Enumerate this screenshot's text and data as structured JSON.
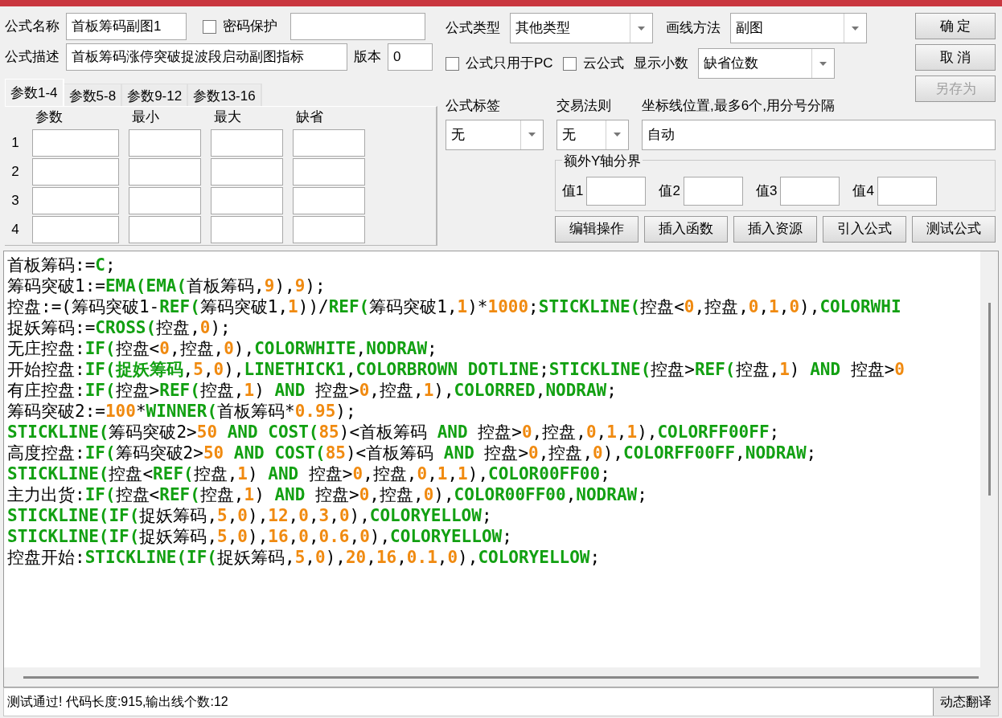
{
  "form": {
    "name_label": "公式名称",
    "name_value": "首板筹码副图1",
    "password": {
      "label": "密码保护",
      "checked": false
    },
    "desc_label": "公式描述",
    "desc_value": "首板筹码涨停突破捉波段启动副图指标",
    "version_label": "版本",
    "version_value": "0"
  },
  "param_tabs": [
    {
      "label": "参数1-4",
      "selected": true
    },
    {
      "label": "参数5-8",
      "selected": false
    },
    {
      "label": "参数9-12",
      "selected": false
    },
    {
      "label": "参数13-16",
      "selected": false
    }
  ],
  "param_columns": [
    "参数",
    "最小",
    "最大",
    "缺省"
  ],
  "param_rows": [
    "1",
    "2",
    "3",
    "4"
  ],
  "formula_type": {
    "label": "公式类型",
    "value": "其他类型"
  },
  "draw_method": {
    "label": "画线方法",
    "value": "副图"
  },
  "pc_only": {
    "label": "公式只用于PC",
    "checked": false
  },
  "cloud": {
    "label": "云公式",
    "checked": false
  },
  "decimals": {
    "label": "显示小数",
    "value": "缺省位数"
  },
  "buttons": [
    {
      "label": "确 定",
      "disabled": false
    },
    {
      "label": "取 消",
      "disabled": false
    },
    {
      "label": "另存为",
      "disabled": true
    }
  ],
  "tag": {
    "label": "公式标签",
    "value": "无"
  },
  "rule": {
    "label": "交易法则",
    "value": "无"
  },
  "axis": {
    "label": "坐标线位置,最多6个,用分号分隔",
    "value": "自动"
  },
  "y_bounds": {
    "title": "额外Y轴分界",
    "fields": [
      "值1",
      "值2",
      "值3",
      "值4"
    ]
  },
  "actions": [
    "编辑操作",
    "插入函数",
    "插入资源",
    "引入公式",
    "测试公式"
  ],
  "code_lines": [
    [
      {
        "kind": "n",
        "text": "首板筹码:="
      },
      {
        "kind": "f",
        "text": "C"
      },
      {
        "kind": "n",
        "text": ";"
      }
    ],
    [
      {
        "kind": "n",
        "text": "筹码突破1:="
      },
      {
        "kind": "f",
        "text": "EMA(EMA("
      },
      {
        "kind": "n",
        "text": "首板筹码,"
      },
      {
        "kind": "v",
        "text": "9"
      },
      {
        "kind": "n",
        "text": "),"
      },
      {
        "kind": "v",
        "text": "9"
      },
      {
        "kind": "n",
        "text": ");"
      }
    ],
    [
      {
        "kind": "n",
        "text": "控盘:=(筹码突破1-"
      },
      {
        "kind": "f",
        "text": "REF("
      },
      {
        "kind": "n",
        "text": "筹码突破1,"
      },
      {
        "kind": "v",
        "text": "1"
      },
      {
        "kind": "n",
        "text": "))/"
      },
      {
        "kind": "f",
        "text": "REF("
      },
      {
        "kind": "n",
        "text": "筹码突破1,"
      },
      {
        "kind": "v",
        "text": "1"
      },
      {
        "kind": "n",
        "text": ")*"
      },
      {
        "kind": "v",
        "text": "1000"
      },
      {
        "kind": "n",
        "text": ";"
      },
      {
        "kind": "f",
        "text": "STICKLINE("
      },
      {
        "kind": "n",
        "text": "控盘<"
      },
      {
        "kind": "v",
        "text": "0"
      },
      {
        "kind": "n",
        "text": ",控盘,"
      },
      {
        "kind": "v",
        "text": "0"
      },
      {
        "kind": "n",
        "text": ","
      },
      {
        "kind": "v",
        "text": "1"
      },
      {
        "kind": "n",
        "text": ","
      },
      {
        "kind": "v",
        "text": "0"
      },
      {
        "kind": "n",
        "text": "),"
      },
      {
        "kind": "f",
        "text": "COLORWHI"
      }
    ],
    [
      {
        "kind": "n",
        "text": "捉妖筹码:="
      },
      {
        "kind": "f",
        "text": "CROSS("
      },
      {
        "kind": "n",
        "text": "控盘,"
      },
      {
        "kind": "v",
        "text": "0"
      },
      {
        "kind": "n",
        "text": ");"
      }
    ],
    [
      {
        "kind": "n",
        "text": "无庄控盘:"
      },
      {
        "kind": "f",
        "text": "IF("
      },
      {
        "kind": "n",
        "text": "控盘<"
      },
      {
        "kind": "v",
        "text": "0"
      },
      {
        "kind": "n",
        "text": ",控盘,"
      },
      {
        "kind": "v",
        "text": "0"
      },
      {
        "kind": "n",
        "text": "),"
      },
      {
        "kind": "f",
        "text": "COLORWHITE"
      },
      {
        "kind": "n",
        "text": ","
      },
      {
        "kind": "f",
        "text": "NODRAW"
      },
      {
        "kind": "n",
        "text": ";"
      }
    ],
    [
      {
        "kind": "n",
        "text": "开始控盘:"
      },
      {
        "kind": "f",
        "text": "IF(捉妖筹码"
      },
      {
        "kind": "n",
        "text": ","
      },
      {
        "kind": "v",
        "text": "5"
      },
      {
        "kind": "n",
        "text": ","
      },
      {
        "kind": "v",
        "text": "0"
      },
      {
        "kind": "n",
        "text": "),"
      },
      {
        "kind": "f",
        "text": "LINETHICK1"
      },
      {
        "kind": "n",
        "text": ","
      },
      {
        "kind": "f",
        "text": "COLORBROWN DOTLINE"
      },
      {
        "kind": "n",
        "text": ";"
      },
      {
        "kind": "f",
        "text": "STICKLINE("
      },
      {
        "kind": "n",
        "text": "控盘>"
      },
      {
        "kind": "f",
        "text": "REF("
      },
      {
        "kind": "n",
        "text": "控盘,"
      },
      {
        "kind": "v",
        "text": "1"
      },
      {
        "kind": "n",
        "text": ") "
      },
      {
        "kind": "f",
        "text": "AND"
      },
      {
        "kind": "n",
        "text": " 控盘>"
      },
      {
        "kind": "v",
        "text": "0"
      }
    ],
    [
      {
        "kind": "n",
        "text": "有庄控盘:"
      },
      {
        "kind": "f",
        "text": "IF("
      },
      {
        "kind": "n",
        "text": "控盘>"
      },
      {
        "kind": "f",
        "text": "REF("
      },
      {
        "kind": "n",
        "text": "控盘,"
      },
      {
        "kind": "v",
        "text": "1"
      },
      {
        "kind": "n",
        "text": ") "
      },
      {
        "kind": "f",
        "text": "AND"
      },
      {
        "kind": "n",
        "text": " 控盘>"
      },
      {
        "kind": "v",
        "text": "0"
      },
      {
        "kind": "n",
        "text": ",控盘,"
      },
      {
        "kind": "v",
        "text": "1"
      },
      {
        "kind": "n",
        "text": "),"
      },
      {
        "kind": "f",
        "text": "COLORRED"
      },
      {
        "kind": "n",
        "text": ","
      },
      {
        "kind": "f",
        "text": "NODRAW"
      },
      {
        "kind": "n",
        "text": ";"
      }
    ],
    [
      {
        "kind": "n",
        "text": "筹码突破2:="
      },
      {
        "kind": "v",
        "text": "100"
      },
      {
        "kind": "n",
        "text": "*"
      },
      {
        "kind": "f",
        "text": "WINNER("
      },
      {
        "kind": "n",
        "text": "首板筹码*"
      },
      {
        "kind": "v",
        "text": "0.95"
      },
      {
        "kind": "n",
        "text": ");"
      }
    ],
    [
      {
        "kind": "f",
        "text": "STICKLINE("
      },
      {
        "kind": "n",
        "text": "筹码突破2>"
      },
      {
        "kind": "v",
        "text": "50"
      },
      {
        "kind": "f",
        "text": " AND COST("
      },
      {
        "kind": "v",
        "text": "85"
      },
      {
        "kind": "n",
        "text": ")<首板筹码 "
      },
      {
        "kind": "f",
        "text": "AND"
      },
      {
        "kind": "n",
        "text": " 控盘>"
      },
      {
        "kind": "v",
        "text": "0"
      },
      {
        "kind": "n",
        "text": ",控盘,"
      },
      {
        "kind": "v",
        "text": "0"
      },
      {
        "kind": "n",
        "text": ","
      },
      {
        "kind": "v",
        "text": "1"
      },
      {
        "kind": "n",
        "text": ","
      },
      {
        "kind": "v",
        "text": "1"
      },
      {
        "kind": "n",
        "text": "),"
      },
      {
        "kind": "f",
        "text": "COLORFF00FF"
      },
      {
        "kind": "n",
        "text": ";"
      }
    ],
    [
      {
        "kind": "n",
        "text": "高度控盘:"
      },
      {
        "kind": "f",
        "text": "IF("
      },
      {
        "kind": "n",
        "text": "筹码突破2>"
      },
      {
        "kind": "v",
        "text": "50"
      },
      {
        "kind": "f",
        "text": " AND COST("
      },
      {
        "kind": "v",
        "text": "85"
      },
      {
        "kind": "n",
        "text": ")<首板筹码 "
      },
      {
        "kind": "f",
        "text": "AND"
      },
      {
        "kind": "n",
        "text": " 控盘>"
      },
      {
        "kind": "v",
        "text": "0"
      },
      {
        "kind": "n",
        "text": ",控盘,"
      },
      {
        "kind": "v",
        "text": "0"
      },
      {
        "kind": "n",
        "text": "),"
      },
      {
        "kind": "f",
        "text": "COLORFF00FF"
      },
      {
        "kind": "n",
        "text": ","
      },
      {
        "kind": "f",
        "text": "NODRAW"
      },
      {
        "kind": "n",
        "text": ";"
      }
    ],
    [
      {
        "kind": "f",
        "text": "STICKLINE("
      },
      {
        "kind": "n",
        "text": "控盘<"
      },
      {
        "kind": "f",
        "text": "REF("
      },
      {
        "kind": "n",
        "text": "控盘,"
      },
      {
        "kind": "v",
        "text": "1"
      },
      {
        "kind": "n",
        "text": ") "
      },
      {
        "kind": "f",
        "text": "AND"
      },
      {
        "kind": "n",
        "text": " 控盘>"
      },
      {
        "kind": "v",
        "text": "0"
      },
      {
        "kind": "n",
        "text": ",控盘,"
      },
      {
        "kind": "v",
        "text": "0"
      },
      {
        "kind": "n",
        "text": ","
      },
      {
        "kind": "v",
        "text": "1"
      },
      {
        "kind": "n",
        "text": ","
      },
      {
        "kind": "v",
        "text": "1"
      },
      {
        "kind": "n",
        "text": "),"
      },
      {
        "kind": "f",
        "text": "COLOR00FF00"
      },
      {
        "kind": "n",
        "text": ";"
      }
    ],
    [
      {
        "kind": "n",
        "text": "主力出货:"
      },
      {
        "kind": "f",
        "text": "IF("
      },
      {
        "kind": "n",
        "text": "控盘<"
      },
      {
        "kind": "f",
        "text": "REF("
      },
      {
        "kind": "n",
        "text": "控盘,"
      },
      {
        "kind": "v",
        "text": "1"
      },
      {
        "kind": "n",
        "text": ") "
      },
      {
        "kind": "f",
        "text": "AND"
      },
      {
        "kind": "n",
        "text": " 控盘>"
      },
      {
        "kind": "v",
        "text": "0"
      },
      {
        "kind": "n",
        "text": ",控盘,"
      },
      {
        "kind": "v",
        "text": "0"
      },
      {
        "kind": "n",
        "text": "),"
      },
      {
        "kind": "f",
        "text": "COLOR00FF00"
      },
      {
        "kind": "n",
        "text": ","
      },
      {
        "kind": "f",
        "text": "NODRAW"
      },
      {
        "kind": "n",
        "text": ";"
      }
    ],
    [
      {
        "kind": "f",
        "text": "STICKLINE(IF("
      },
      {
        "kind": "n",
        "text": "捉妖筹码,"
      },
      {
        "kind": "v",
        "text": "5"
      },
      {
        "kind": "n",
        "text": ","
      },
      {
        "kind": "v",
        "text": "0"
      },
      {
        "kind": "n",
        "text": "),"
      },
      {
        "kind": "v",
        "text": "12"
      },
      {
        "kind": "n",
        "text": ","
      },
      {
        "kind": "v",
        "text": "0"
      },
      {
        "kind": "n",
        "text": ","
      },
      {
        "kind": "v",
        "text": "3"
      },
      {
        "kind": "n",
        "text": ","
      },
      {
        "kind": "v",
        "text": "0"
      },
      {
        "kind": "n",
        "text": "),"
      },
      {
        "kind": "f",
        "text": "COLORYELLOW"
      },
      {
        "kind": "n",
        "text": ";"
      }
    ],
    [
      {
        "kind": "f",
        "text": "STICKLINE(IF("
      },
      {
        "kind": "n",
        "text": "捉妖筹码,"
      },
      {
        "kind": "v",
        "text": "5"
      },
      {
        "kind": "n",
        "text": ","
      },
      {
        "kind": "v",
        "text": "0"
      },
      {
        "kind": "n",
        "text": "),"
      },
      {
        "kind": "v",
        "text": "16"
      },
      {
        "kind": "n",
        "text": ","
      },
      {
        "kind": "v",
        "text": "0"
      },
      {
        "kind": "n",
        "text": ","
      },
      {
        "kind": "v",
        "text": "0.6"
      },
      {
        "kind": "n",
        "text": ","
      },
      {
        "kind": "v",
        "text": "0"
      },
      {
        "kind": "n",
        "text": "),"
      },
      {
        "kind": "f",
        "text": "COLORYELLOW"
      },
      {
        "kind": "n",
        "text": ";"
      }
    ],
    [
      {
        "kind": "n",
        "text": "控盘开始:"
      },
      {
        "kind": "f",
        "text": "STICKLINE(IF("
      },
      {
        "kind": "n",
        "text": "捉妖筹码,"
      },
      {
        "kind": "v",
        "text": "5"
      },
      {
        "kind": "n",
        "text": ","
      },
      {
        "kind": "v",
        "text": "0"
      },
      {
        "kind": "n",
        "text": "),"
      },
      {
        "kind": "v",
        "text": "20"
      },
      {
        "kind": "n",
        "text": ","
      },
      {
        "kind": "v",
        "text": "16"
      },
      {
        "kind": "n",
        "text": ","
      },
      {
        "kind": "v",
        "text": "0.1"
      },
      {
        "kind": "n",
        "text": ","
      },
      {
        "kind": "v",
        "text": "0"
      },
      {
        "kind": "n",
        "text": "),"
      },
      {
        "kind": "f",
        "text": "COLORYELLOW"
      },
      {
        "kind": "n",
        "text": ";"
      }
    ]
  ],
  "status": "测试通过! 代码长度:915,输出线个数:12",
  "translate_button": "动态翻译"
}
